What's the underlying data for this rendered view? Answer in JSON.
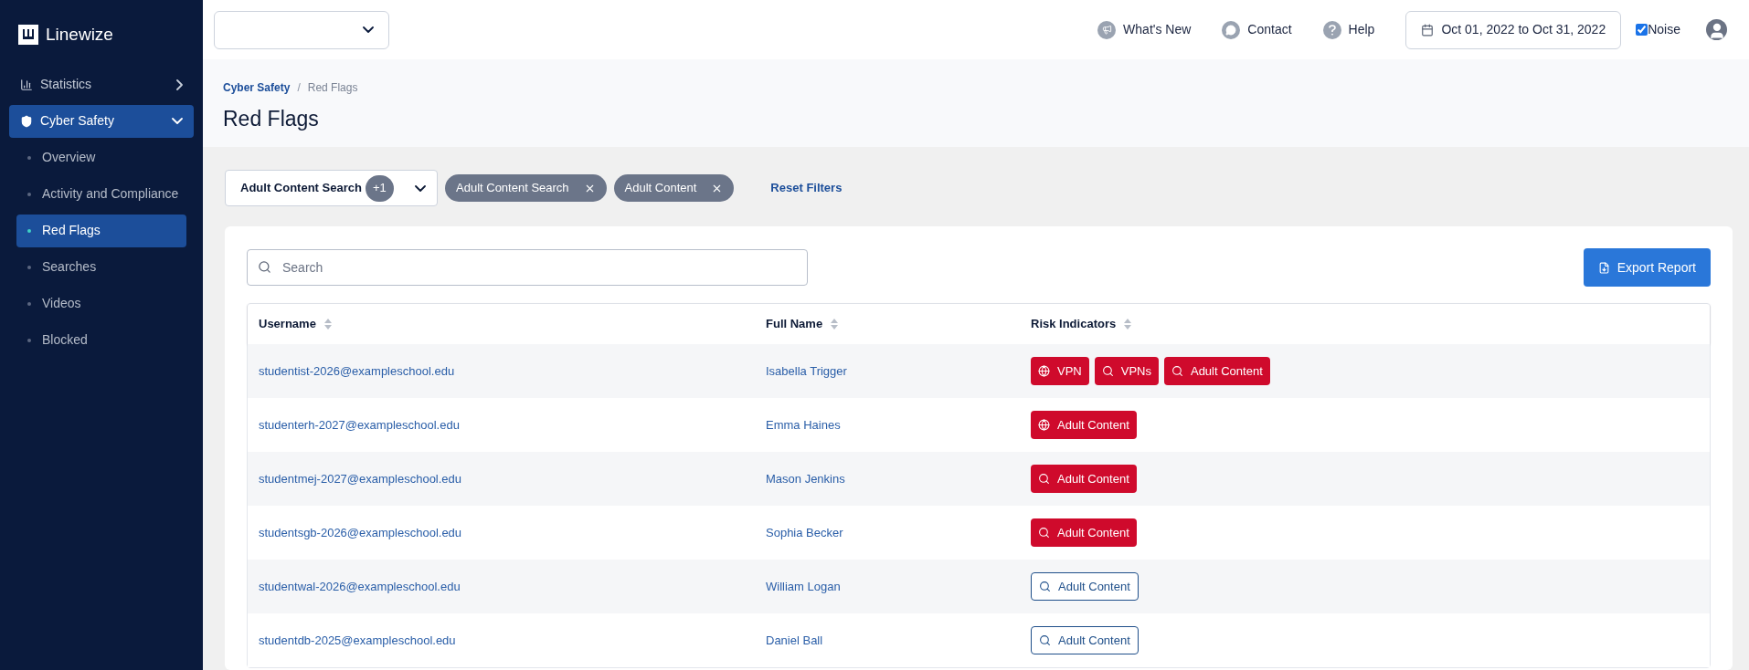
{
  "brand": {
    "name": "Linewize"
  },
  "sidebar": {
    "items": [
      {
        "label": "Statistics",
        "expanded": false,
        "selected": false
      },
      {
        "label": "Cyber Safety",
        "expanded": true,
        "selected": true,
        "children": [
          {
            "label": "Overview",
            "selected": false
          },
          {
            "label": "Activity and Compliance",
            "selected": false
          },
          {
            "label": "Red Flags",
            "selected": true
          },
          {
            "label": "Searches",
            "selected": false
          },
          {
            "label": "Videos",
            "selected": false
          },
          {
            "label": "Blocked",
            "selected": false
          }
        ]
      }
    ]
  },
  "topbar": {
    "links": [
      "What's New",
      "Contact",
      "Help"
    ],
    "date_range": "Oct 01, 2022 to Oct 31, 2022",
    "noise": {
      "label": "Noise",
      "checked": true
    }
  },
  "breadcrumb": {
    "items": [
      "Cyber Safety",
      "Red Flags"
    ],
    "separator": "/"
  },
  "page_title": "Red Flags",
  "filters": {
    "select": {
      "value": "Adult Content Search",
      "count": "+1"
    },
    "chips": [
      "Adult Content Search",
      "Adult Content"
    ],
    "reset": "Reset Filters"
  },
  "search": {
    "placeholder": "Search"
  },
  "export_button": "Export Report",
  "table": {
    "columns": [
      "Username",
      "Full Name",
      "Risk Indicators"
    ],
    "rows": [
      {
        "username": "studentist-2026@exampleschool.edu",
        "full_name": "Isabella Trigger",
        "risks": [
          {
            "label": "VPN",
            "kind": "web",
            "active": true
          },
          {
            "label": "VPNs",
            "kind": "search",
            "active": true
          },
          {
            "label": "Adult Content",
            "kind": "search",
            "active": true
          }
        ]
      },
      {
        "username": "studenterh-2027@exampleschool.edu",
        "full_name": "Emma Haines",
        "risks": [
          {
            "label": "Adult Content",
            "kind": "web",
            "active": true
          }
        ]
      },
      {
        "username": "studentmej-2027@exampleschool.edu",
        "full_name": "Mason Jenkins",
        "risks": [
          {
            "label": "Adult Content",
            "kind": "search",
            "active": true
          }
        ]
      },
      {
        "username": "studentsgb-2026@exampleschool.edu",
        "full_name": "Sophia Becker",
        "risks": [
          {
            "label": "Adult Content",
            "kind": "search",
            "active": true
          }
        ]
      },
      {
        "username": "studentwal-2026@exampleschool.edu",
        "full_name": "William Logan",
        "risks": [
          {
            "label": "Adult Content",
            "kind": "search",
            "active": false
          }
        ]
      },
      {
        "username": "studentdb-2025@exampleschool.edu",
        "full_name": "Daniel Ball",
        "risks": [
          {
            "label": "Adult Content",
            "kind": "search",
            "active": false
          }
        ]
      }
    ]
  }
}
